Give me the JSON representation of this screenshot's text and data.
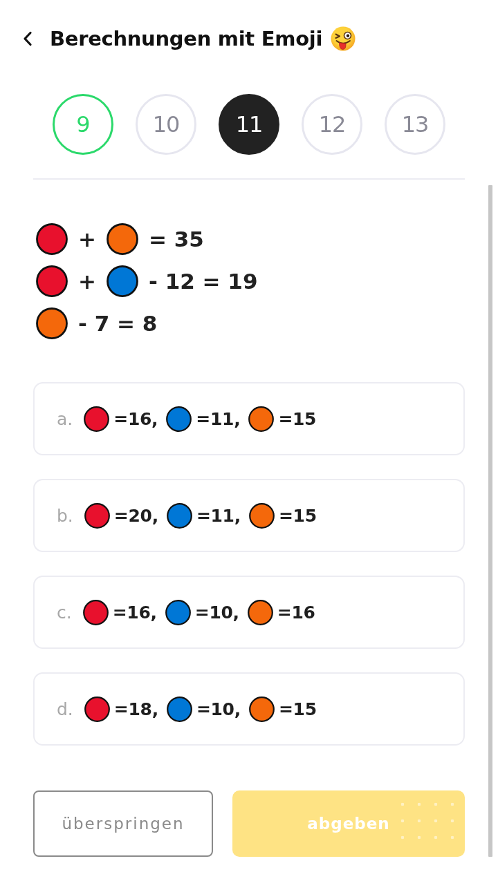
{
  "header": {
    "title": "Berechnungen mit Emoji"
  },
  "questions": [
    {
      "label": "9",
      "correct": true,
      "selected": false
    },
    {
      "label": "10",
      "correct": false,
      "selected": false
    },
    {
      "label": "11",
      "correct": false,
      "selected": true
    },
    {
      "label": "12",
      "correct": false,
      "selected": false
    },
    {
      "label": "13",
      "correct": false,
      "selected": false
    }
  ],
  "equations": [
    {
      "terms": [
        {
          "kind": "ball",
          "color": "#e8112d"
        },
        {
          "kind": "text",
          "text": "+"
        },
        {
          "kind": "ball",
          "color": "#f4680b"
        },
        {
          "kind": "text",
          "text": "= 35"
        }
      ]
    },
    {
      "terms": [
        {
          "kind": "ball",
          "color": "#e8112d"
        },
        {
          "kind": "text",
          "text": "+"
        },
        {
          "kind": "ball",
          "color": "#0077d6"
        },
        {
          "kind": "text",
          "text": "- 12 = 19"
        }
      ]
    },
    {
      "terms": [
        {
          "kind": "ball",
          "color": "#f4680b"
        },
        {
          "kind": "text",
          "text": "- 7 = 8"
        }
      ]
    }
  ],
  "options": [
    {
      "letter": "a.",
      "selected": false,
      "terms": [
        {
          "color": "#e8112d",
          "value": "=16,"
        },
        {
          "color": "#0077d6",
          "value": "=11,"
        },
        {
          "color": "#f4680b",
          "value": "=15"
        }
      ]
    },
    {
      "letter": "b.",
      "selected": false,
      "terms": [
        {
          "color": "#e8112d",
          "value": "=20,"
        },
        {
          "color": "#0077d6",
          "value": "=11,"
        },
        {
          "color": "#f4680b",
          "value": "=15"
        }
      ]
    },
    {
      "letter": "c.",
      "selected": false,
      "terms": [
        {
          "color": "#e8112d",
          "value": "=16,"
        },
        {
          "color": "#0077d6",
          "value": "=10,"
        },
        {
          "color": "#f4680b",
          "value": "=16"
        }
      ]
    },
    {
      "letter": "d.",
      "selected": false,
      "terms": [
        {
          "color": "#e8112d",
          "value": "=18,"
        },
        {
          "color": "#0077d6",
          "value": "=10,"
        },
        {
          "color": "#f4680b",
          "value": "=15"
        }
      ]
    }
  ],
  "buttons": [
    {
      "kind": "outline",
      "label": "überspringen",
      "disabled": false
    },
    {
      "kind": "primary",
      "label": "abgeben",
      "disabled": true
    }
  ]
}
